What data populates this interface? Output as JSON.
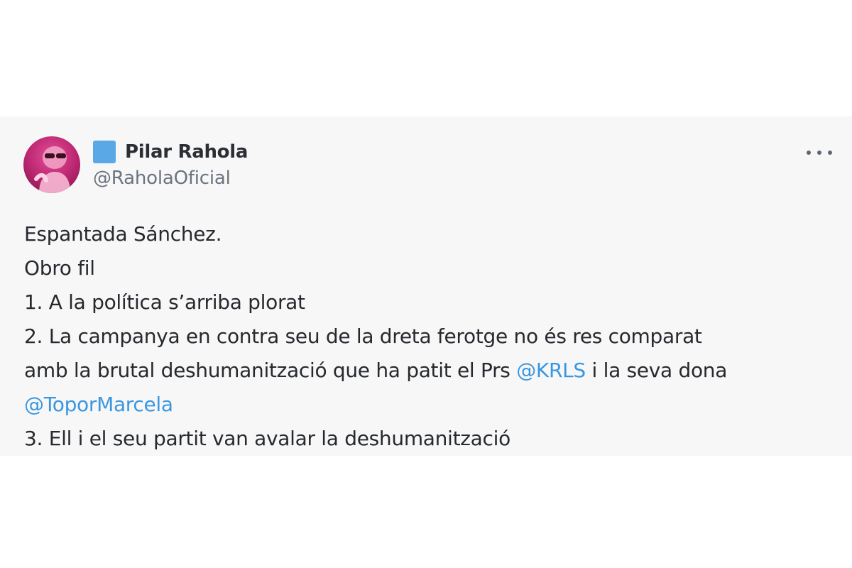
{
  "tweet": {
    "author": {
      "name": "Pilar Rahola",
      "handle": "@RaholaOficial",
      "badge_color": "#5aa9e6",
      "avatar_icon": "profile-photo"
    },
    "more_icon": "ellipsis-icon",
    "body": {
      "line1": "Espantada Sánchez.",
      "line2": "Obro fil",
      "line3": "1. A la política s’arriba plorat",
      "line4": "2. La campanya en contra seu de la dreta ferotge no és res comparat",
      "line5_prefix": "amb la brutal deshumanització que ha patit el Prs ",
      "mention1": "@KRLS",
      "line5_suffix": " i la seva dona",
      "mention2": "@ToporMarcela",
      "line7": "3. Ell i el seu partit van avalar la deshumanització"
    },
    "colors": {
      "mention": "#3a97df",
      "text": "#26292d",
      "handle": "#6b7480"
    }
  }
}
